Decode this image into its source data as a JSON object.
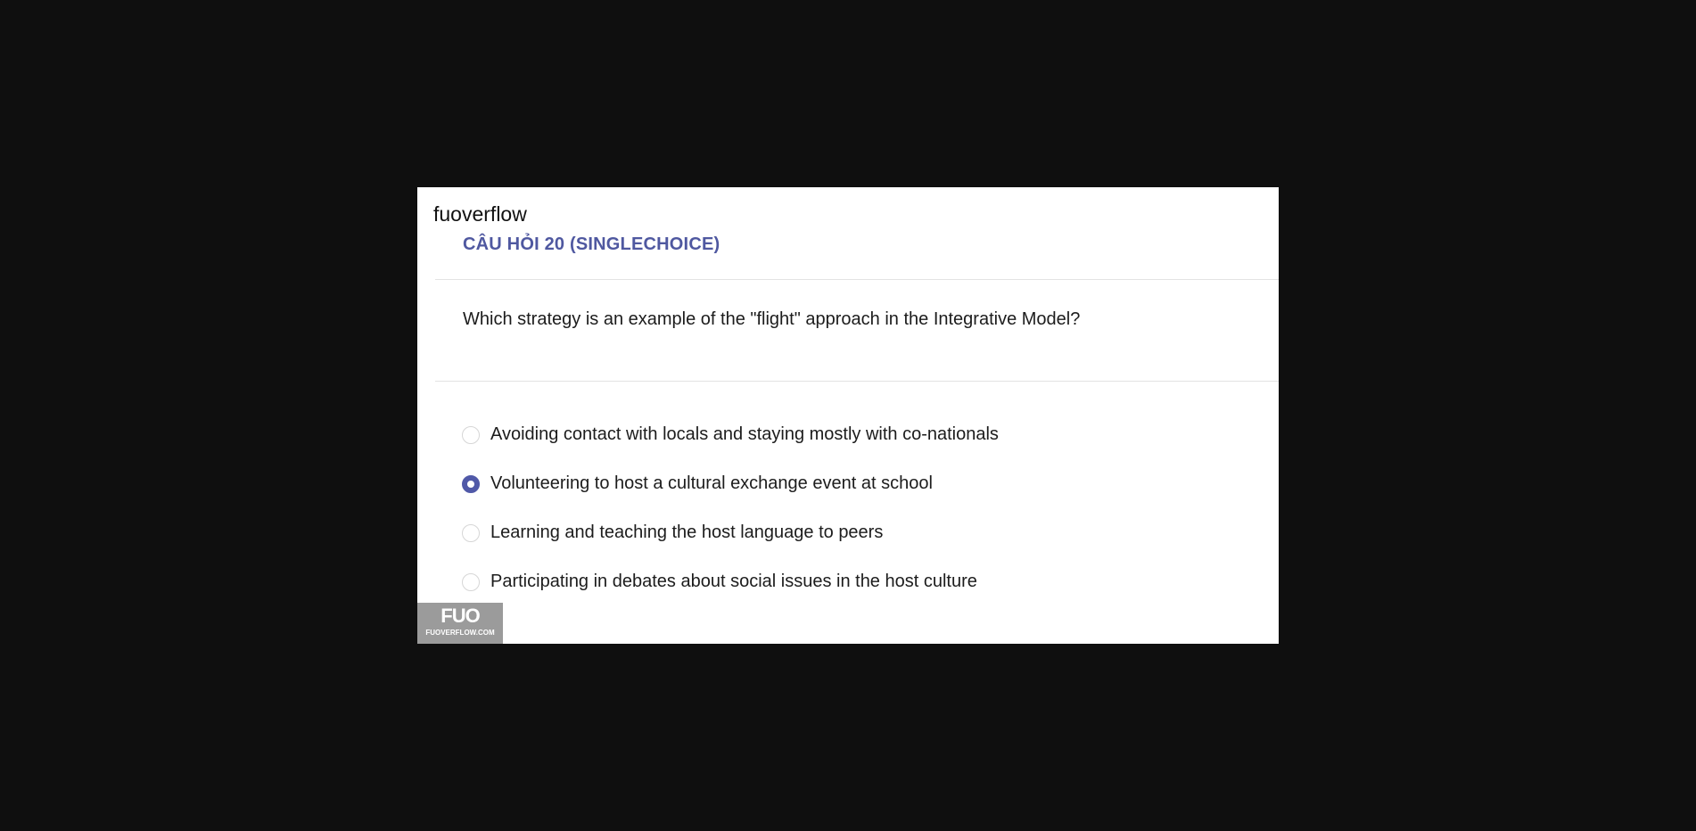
{
  "site": {
    "name": "fuoverflow"
  },
  "question": {
    "header": "CÂU HỎI 20 (SINGLECHOICE)",
    "text": "Which strategy is an example of the \"flight\" approach in the Integrative Model?"
  },
  "options": [
    {
      "label": "Avoiding contact with locals and staying mostly with co-nationals",
      "selected": false
    },
    {
      "label": "Volunteering to host a cultural exchange event at school",
      "selected": true
    },
    {
      "label": "Learning and teaching the host language to peers",
      "selected": false
    },
    {
      "label": "Participating in debates about social issues in the host culture",
      "selected": false
    }
  ],
  "watermark": {
    "logo": "FUO",
    "url": "FUOVERFLOW.COM"
  },
  "colors": {
    "accent": "#5059a8",
    "header": "#4f58a0",
    "background": "#0f0f0f",
    "card": "#ffffff"
  }
}
